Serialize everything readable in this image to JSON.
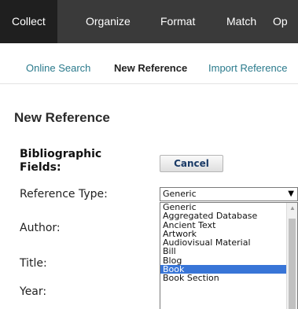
{
  "topnav": {
    "items": [
      {
        "label": "Collect"
      },
      {
        "label": "Organize"
      },
      {
        "label": "Format"
      },
      {
        "label": "Match"
      },
      {
        "label": "Op"
      }
    ],
    "active_index": 0
  },
  "subnav": {
    "items": [
      {
        "label": "Online Search"
      },
      {
        "label": "New Reference"
      },
      {
        "label": "Import Reference"
      }
    ],
    "active_index": 1
  },
  "page_title": "New Reference",
  "form": {
    "section_title": "Bibliographic Fields:",
    "cancel_label": "Cancel",
    "reference_type_label": "Reference Type:",
    "author_label": "Author:",
    "title_label": "Title:",
    "year_label": "Year:",
    "reference_type_value": "Generic",
    "arrow_glyph": "▼"
  },
  "dropdown": {
    "options": [
      "Generic",
      "Aggregated Database",
      "Ancient Text",
      "Artwork",
      "Audiovisual Material",
      "Bill",
      "Blog",
      "Book",
      "Book Section"
    ],
    "highlighted": "Book",
    "highlight_color": "#3875d7"
  },
  "colors": {
    "topnav_bg": "#3a3a3a",
    "topnav_active_bg": "#1f1f1f",
    "link_color": "#2a7a8c"
  }
}
